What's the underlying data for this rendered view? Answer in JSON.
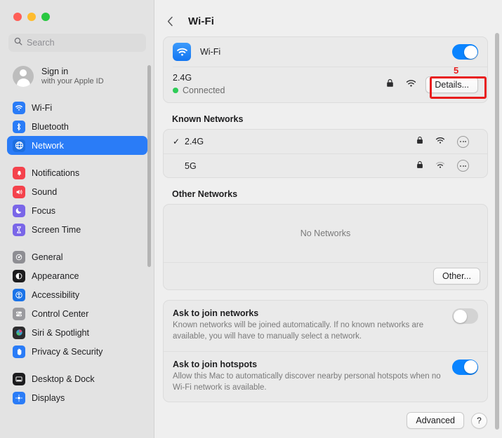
{
  "window": {
    "traffic_lights": [
      "close",
      "minimize",
      "maximize"
    ]
  },
  "sidebar": {
    "search": {
      "placeholder": "Search",
      "value": "",
      "icon": "search-icon"
    },
    "account": {
      "name": "Sign in",
      "subtitle": "with your Apple ID",
      "icon": "avatar-person-icon"
    },
    "groups": [
      {
        "items": [
          {
            "label": "Wi-Fi",
            "icon": "wifi-icon",
            "color": "#2a7cf7",
            "active": false
          },
          {
            "label": "Bluetooth",
            "icon": "bluetooth-icon",
            "color": "#2a7cf7",
            "active": false
          },
          {
            "label": "Network",
            "icon": "globe-icon",
            "color": "#2a7cf7",
            "active": true
          }
        ]
      },
      {
        "items": [
          {
            "label": "Notifications",
            "icon": "bell-icon",
            "color": "#f4424c",
            "active": false
          },
          {
            "label": "Sound",
            "icon": "speaker-icon",
            "color": "#f4424c",
            "active": false
          },
          {
            "label": "Focus",
            "icon": "moon-icon",
            "color": "#7a66e8",
            "active": false
          },
          {
            "label": "Screen Time",
            "icon": "hourglass-icon",
            "color": "#7a66e8",
            "active": false
          }
        ]
      },
      {
        "items": [
          {
            "label": "General",
            "icon": "gear-icon",
            "color": "#8e8e93",
            "active": false
          },
          {
            "label": "Appearance",
            "icon": "appearance-icon",
            "color": "#1c1c1e",
            "active": false
          },
          {
            "label": "Accessibility",
            "icon": "accessibility-icon",
            "color": "#1a73e8",
            "active": false
          },
          {
            "label": "Control Center",
            "icon": "control-center-icon",
            "color": "#9a9a9e",
            "active": false
          },
          {
            "label": "Siri & Spotlight",
            "icon": "siri-icon",
            "color": "#2c2c2e",
            "active": false
          },
          {
            "label": "Privacy & Security",
            "icon": "hand-icon",
            "color": "#2a7cf7",
            "active": false
          }
        ]
      },
      {
        "items": [
          {
            "label": "Desktop & Dock",
            "icon": "desktop-dock-icon",
            "color": "#1c1c1e",
            "active": false
          },
          {
            "label": "Displays",
            "icon": "displays-icon",
            "color": "#2a7cf7",
            "active": false
          }
        ]
      }
    ]
  },
  "main": {
    "back_label": "‹",
    "title": "Wi-Fi",
    "wifi_card": {
      "icon": "wifi-icon",
      "label": "Wi-Fi",
      "toggle_state": "on",
      "connected_network": {
        "name": "2.4G",
        "status": "Connected",
        "lock_icon": "lock-icon",
        "signal_icon": "wifi-signal-icon",
        "details_button": "Details..."
      }
    },
    "known_networks": {
      "title": "Known Networks",
      "rows": [
        {
          "check": "✓",
          "name": "2.4G",
          "lock_icon": "lock-icon",
          "signal_icon": "wifi-signal-icon",
          "signal_strength": "full",
          "more_icon": "more-options-icon"
        },
        {
          "check": "",
          "name": "5G",
          "lock_icon": "lock-icon",
          "signal_icon": "wifi-signal-icon",
          "signal_strength": "weak",
          "more_icon": "more-options-icon"
        }
      ]
    },
    "other_networks": {
      "title": "Other Networks",
      "empty_text": "No Networks",
      "other_button": "Other..."
    },
    "preferences": [
      {
        "title": "Ask to join networks",
        "description": "Known networks will be joined automatically. If no known networks are available, you will have to manually select a network.",
        "toggle_state": "off"
      },
      {
        "title": "Ask to join hotspots",
        "description": "Allow this Mac to automatically discover nearby personal hotspots when no Wi-Fi network is available.",
        "toggle_state": "on"
      }
    ],
    "footer": {
      "advanced_button": "Advanced",
      "help_button": "?"
    }
  },
  "annotation": {
    "number": "5",
    "target": "details-button",
    "color": "#e81c1c"
  }
}
